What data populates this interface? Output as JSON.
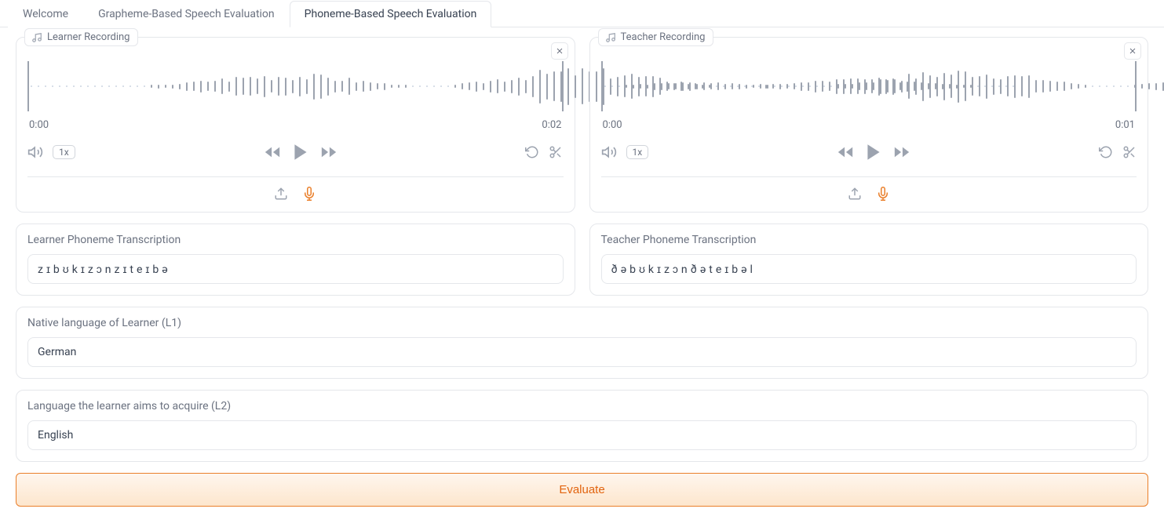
{
  "tabs": {
    "welcome": "Welcome",
    "grapheme": "Grapheme-Based Speech Evaluation",
    "phoneme": "Phoneme-Based Speech Evaluation"
  },
  "learner": {
    "chip_label": "Learner Recording",
    "time_start": "0:00",
    "time_end": "0:02",
    "speed": "1x",
    "transcription_label": "Learner Phoneme Transcription",
    "transcription_value": "zɪbʊkɪzɔnzɪteɪbə"
  },
  "teacher": {
    "chip_label": "Teacher Recording",
    "time_start": "0:00",
    "time_end": "0:01",
    "speed": "1x",
    "transcription_label": "Teacher Phoneme Transcription",
    "transcription_value": "ðəbʊkɪzɔnðəteɪbəl"
  },
  "l1": {
    "label": "Native language of Learner (L1)",
    "value": "German"
  },
  "l2": {
    "label": "Language the learner aims to acquire (L2)",
    "value": "English"
  },
  "evaluate_label": "Evaluate",
  "icons": {
    "music": "music-icon",
    "close": "close-icon",
    "volume": "volume-icon",
    "rewind": "rewind-icon",
    "play": "play-icon",
    "forward": "forward-icon",
    "undo": "undo-icon",
    "scissors": "scissors-icon",
    "upload": "upload-icon",
    "mic": "mic-icon"
  }
}
